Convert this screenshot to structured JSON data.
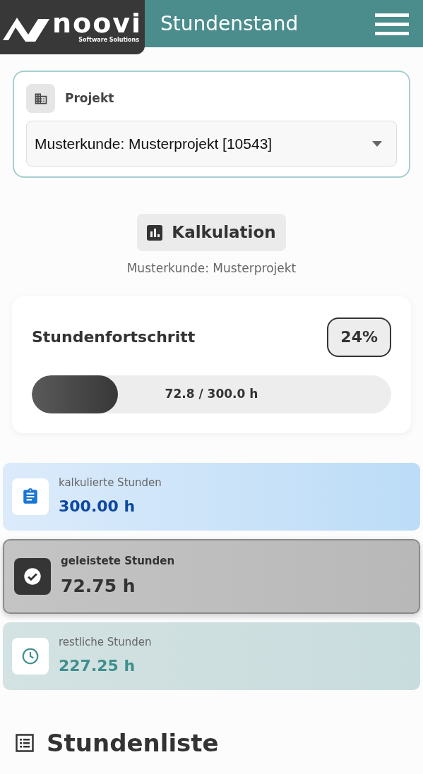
{
  "logo": {
    "name": "noovi",
    "tagline": "Software Solutions"
  },
  "header": {
    "title": "Stundenstand"
  },
  "project": {
    "label": "Projekt",
    "value": "Musterkunde: Musterprojekt [10543]"
  },
  "calculation": {
    "button": "Kalkulation",
    "subtitle": "Musterkunde: Musterprojekt"
  },
  "progress": {
    "title": "Stundenfortschritt",
    "percent": "24%",
    "level": 0.24,
    "reading": "72.8 / 300.0 h"
  },
  "stats": [
    {
      "kind": "planned",
      "label": "kalkulierte Stunden",
      "value": "300.00 h",
      "selected": false
    },
    {
      "kind": "done",
      "label": "geleistete Stunden",
      "value": "72.75 h",
      "selected": true
    },
    {
      "kind": "remaining",
      "label": "restliche Stunden",
      "value": "227.25 h",
      "selected": false
    }
  ],
  "list": {
    "title": "Stundenliste"
  }
}
